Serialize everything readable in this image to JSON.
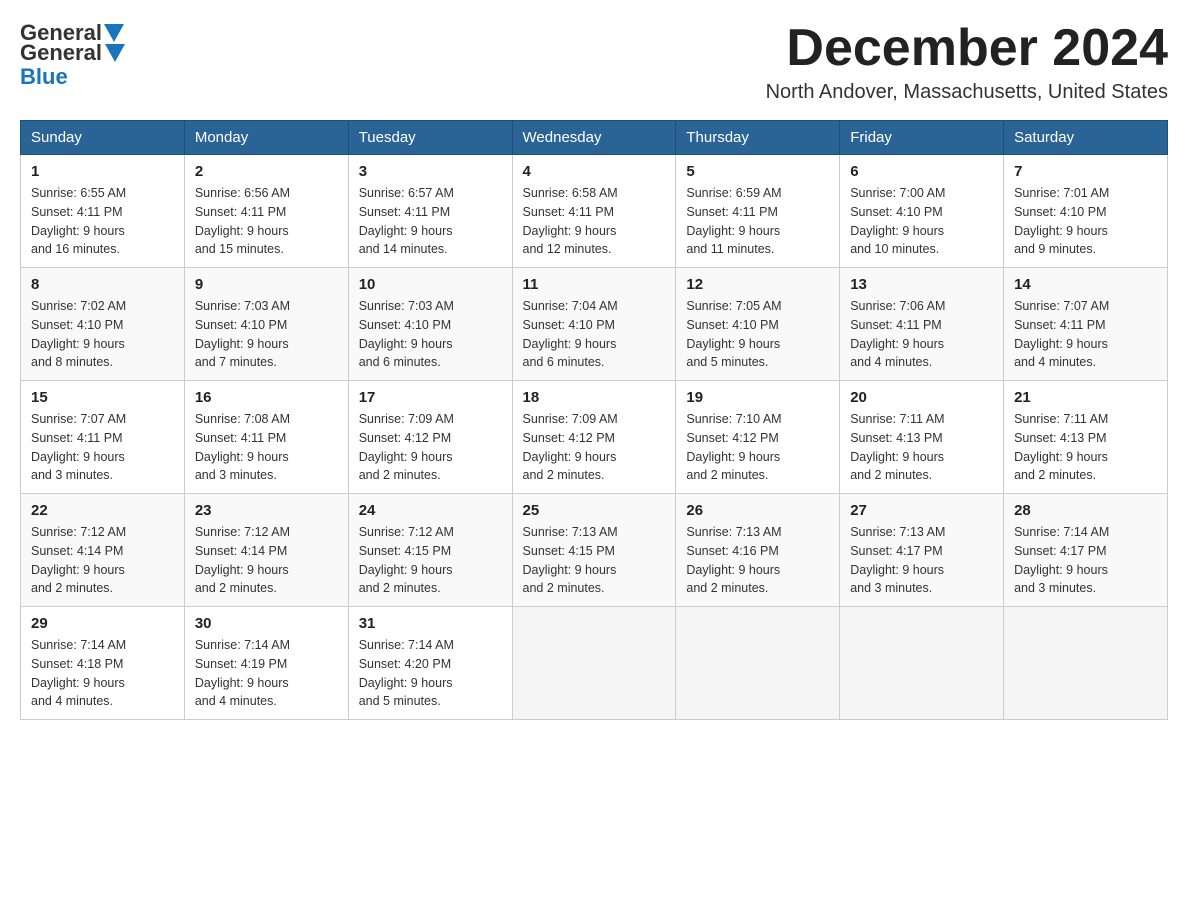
{
  "header": {
    "logo_general": "General",
    "logo_blue": "Blue",
    "month_year": "December 2024",
    "location": "North Andover, Massachusetts, United States"
  },
  "days_of_week": [
    "Sunday",
    "Monday",
    "Tuesday",
    "Wednesday",
    "Thursday",
    "Friday",
    "Saturday"
  ],
  "weeks": [
    [
      {
        "day": "1",
        "sunrise": "6:55 AM",
        "sunset": "4:11 PM",
        "daylight": "9 hours and 16 minutes."
      },
      {
        "day": "2",
        "sunrise": "6:56 AM",
        "sunset": "4:11 PM",
        "daylight": "9 hours and 15 minutes."
      },
      {
        "day": "3",
        "sunrise": "6:57 AM",
        "sunset": "4:11 PM",
        "daylight": "9 hours and 14 minutes."
      },
      {
        "day": "4",
        "sunrise": "6:58 AM",
        "sunset": "4:11 PM",
        "daylight": "9 hours and 12 minutes."
      },
      {
        "day": "5",
        "sunrise": "6:59 AM",
        "sunset": "4:11 PM",
        "daylight": "9 hours and 11 minutes."
      },
      {
        "day": "6",
        "sunrise": "7:00 AM",
        "sunset": "4:10 PM",
        "daylight": "9 hours and 10 minutes."
      },
      {
        "day": "7",
        "sunrise": "7:01 AM",
        "sunset": "4:10 PM",
        "daylight": "9 hours and 9 minutes."
      }
    ],
    [
      {
        "day": "8",
        "sunrise": "7:02 AM",
        "sunset": "4:10 PM",
        "daylight": "9 hours and 8 minutes."
      },
      {
        "day": "9",
        "sunrise": "7:03 AM",
        "sunset": "4:10 PM",
        "daylight": "9 hours and 7 minutes."
      },
      {
        "day": "10",
        "sunrise": "7:03 AM",
        "sunset": "4:10 PM",
        "daylight": "9 hours and 6 minutes."
      },
      {
        "day": "11",
        "sunrise": "7:04 AM",
        "sunset": "4:10 PM",
        "daylight": "9 hours and 6 minutes."
      },
      {
        "day": "12",
        "sunrise": "7:05 AM",
        "sunset": "4:10 PM",
        "daylight": "9 hours and 5 minutes."
      },
      {
        "day": "13",
        "sunrise": "7:06 AM",
        "sunset": "4:11 PM",
        "daylight": "9 hours and 4 minutes."
      },
      {
        "day": "14",
        "sunrise": "7:07 AM",
        "sunset": "4:11 PM",
        "daylight": "9 hours and 4 minutes."
      }
    ],
    [
      {
        "day": "15",
        "sunrise": "7:07 AM",
        "sunset": "4:11 PM",
        "daylight": "9 hours and 3 minutes."
      },
      {
        "day": "16",
        "sunrise": "7:08 AM",
        "sunset": "4:11 PM",
        "daylight": "9 hours and 3 minutes."
      },
      {
        "day": "17",
        "sunrise": "7:09 AM",
        "sunset": "4:12 PM",
        "daylight": "9 hours and 2 minutes."
      },
      {
        "day": "18",
        "sunrise": "7:09 AM",
        "sunset": "4:12 PM",
        "daylight": "9 hours and 2 minutes."
      },
      {
        "day": "19",
        "sunrise": "7:10 AM",
        "sunset": "4:12 PM",
        "daylight": "9 hours and 2 minutes."
      },
      {
        "day": "20",
        "sunrise": "7:11 AM",
        "sunset": "4:13 PM",
        "daylight": "9 hours and 2 minutes."
      },
      {
        "day": "21",
        "sunrise": "7:11 AM",
        "sunset": "4:13 PM",
        "daylight": "9 hours and 2 minutes."
      }
    ],
    [
      {
        "day": "22",
        "sunrise": "7:12 AM",
        "sunset": "4:14 PM",
        "daylight": "9 hours and 2 minutes."
      },
      {
        "day": "23",
        "sunrise": "7:12 AM",
        "sunset": "4:14 PM",
        "daylight": "9 hours and 2 minutes."
      },
      {
        "day": "24",
        "sunrise": "7:12 AM",
        "sunset": "4:15 PM",
        "daylight": "9 hours and 2 minutes."
      },
      {
        "day": "25",
        "sunrise": "7:13 AM",
        "sunset": "4:15 PM",
        "daylight": "9 hours and 2 minutes."
      },
      {
        "day": "26",
        "sunrise": "7:13 AM",
        "sunset": "4:16 PM",
        "daylight": "9 hours and 2 minutes."
      },
      {
        "day": "27",
        "sunrise": "7:13 AM",
        "sunset": "4:17 PM",
        "daylight": "9 hours and 3 minutes."
      },
      {
        "day": "28",
        "sunrise": "7:14 AM",
        "sunset": "4:17 PM",
        "daylight": "9 hours and 3 minutes."
      }
    ],
    [
      {
        "day": "29",
        "sunrise": "7:14 AM",
        "sunset": "4:18 PM",
        "daylight": "9 hours and 4 minutes."
      },
      {
        "day": "30",
        "sunrise": "7:14 AM",
        "sunset": "4:19 PM",
        "daylight": "9 hours and 4 minutes."
      },
      {
        "day": "31",
        "sunrise": "7:14 AM",
        "sunset": "4:20 PM",
        "daylight": "9 hours and 5 minutes."
      },
      null,
      null,
      null,
      null
    ]
  ],
  "labels": {
    "sunrise": "Sunrise:",
    "sunset": "Sunset:",
    "daylight": "Daylight:"
  }
}
